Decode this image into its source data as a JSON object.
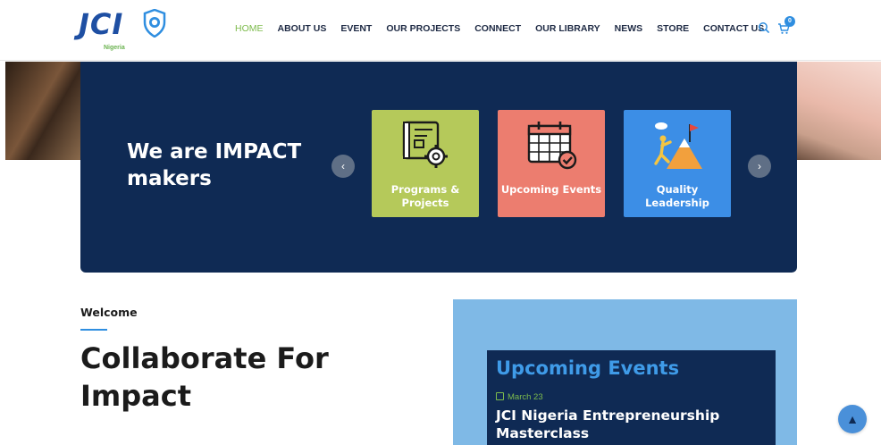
{
  "brand": {
    "logo_text": "JCI",
    "logo_sub": "Nigeria",
    "colors": {
      "navy": "#0f2a54",
      "green": "#7dbb4c",
      "blue": "#2f8ee0"
    }
  },
  "nav": {
    "items": [
      {
        "label": "HOME",
        "active": true
      },
      {
        "label": "ABOUT US",
        "active": false
      },
      {
        "label": "EVENT",
        "active": false
      },
      {
        "label": "OUR PROJECTS",
        "active": false
      },
      {
        "label": "CONNECT",
        "active": false
      },
      {
        "label": "OUR LIBRARY",
        "active": false
      },
      {
        "label": "NEWS",
        "active": false
      },
      {
        "label": "STORE",
        "active": false
      },
      {
        "label": "CONTACT US",
        "active": false
      }
    ],
    "cart_count": "0",
    "icons": [
      "search-icon",
      "cart-icon"
    ]
  },
  "hero": {
    "title": "We are IMPACT makers",
    "prev_icon": "‹",
    "next_icon": "›",
    "cards": [
      {
        "label": "Programs & Projects",
        "icon": "blueprint-gear-icon",
        "color": "#b5c95a"
      },
      {
        "label": "Upcoming Events",
        "icon": "calendar-check-icon",
        "color": "#ec7d6f"
      },
      {
        "label": "Quality Leadership",
        "icon": "mountain-flag-icon",
        "color": "#3c8ee6"
      }
    ]
  },
  "welcome": {
    "label": "Welcome",
    "title": "Collaborate For Impact"
  },
  "events": {
    "title": "Upcoming Events",
    "date": "March 23",
    "event_title": "JCI Nigeria Entrepreneurship Masterclass"
  },
  "scroll_top_icon": "▲"
}
